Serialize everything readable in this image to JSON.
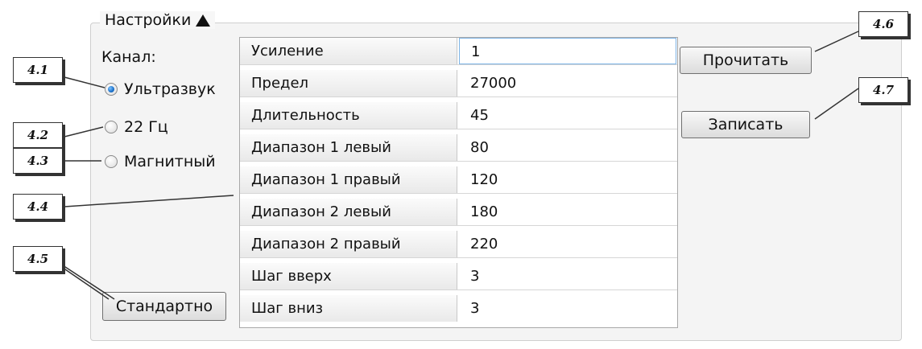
{
  "settings": {
    "title": "Настройки",
    "channel_label": "Канал:",
    "channels": [
      {
        "label": "Ультразвук",
        "selected": true
      },
      {
        "label": "22 Гц",
        "selected": false
      },
      {
        "label": "Магнитный",
        "selected": false
      }
    ],
    "default_button": "Стандартно",
    "read_button": "Прочитать",
    "write_button": "Записать",
    "params": [
      {
        "name": "Усиление",
        "value": "1"
      },
      {
        "name": "Предел",
        "value": "27000"
      },
      {
        "name": "Длительность",
        "value": "45"
      },
      {
        "name": "Диапазон 1 левый",
        "value": "80"
      },
      {
        "name": "Диапазон 1 правый",
        "value": "120"
      },
      {
        "name": "Диапазон 2 левый",
        "value": "180"
      },
      {
        "name": "Диапазон 2 правый",
        "value": "220"
      },
      {
        "name": "Шаг вверх",
        "value": "3"
      },
      {
        "name": "Шаг вниз",
        "value": "3"
      }
    ]
  },
  "callouts": [
    "4.1",
    "4.2",
    "4.3",
    "4.4",
    "4.5",
    "4.6",
    "4.7"
  ],
  "colors": {
    "radio_selected": "#1a6fc9",
    "selected_cell_border": "#7db4e6"
  }
}
